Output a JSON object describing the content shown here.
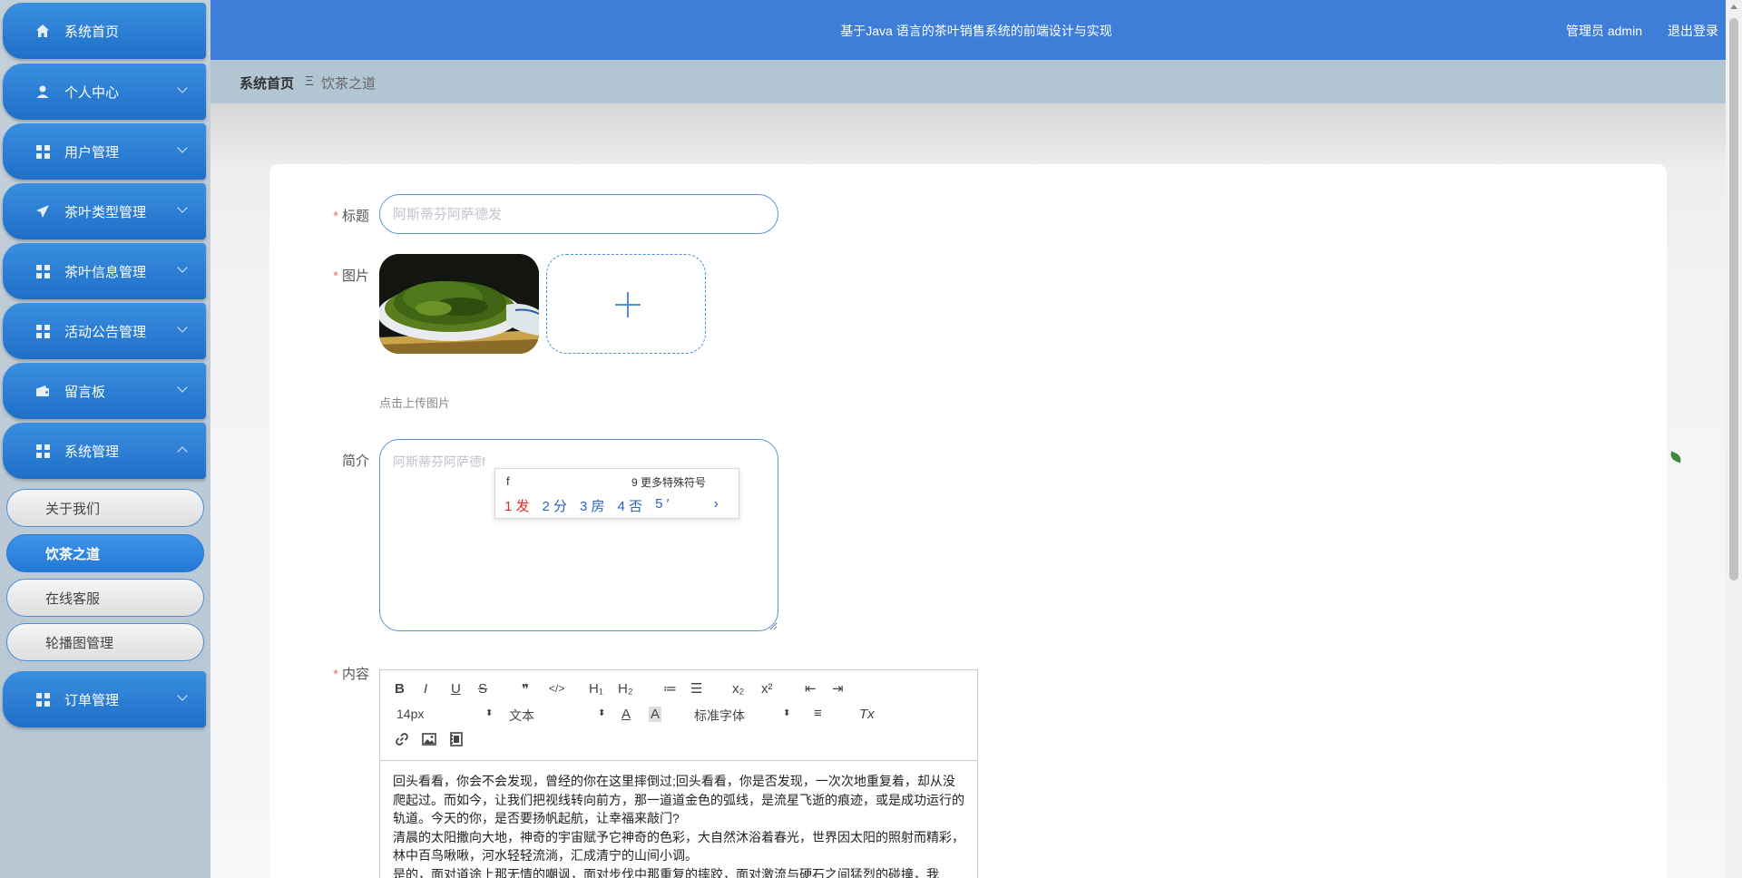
{
  "header": {
    "title": "基于Java 语言的茶叶销售系统的前端设计与实现",
    "user": "管理员 admin",
    "logout": "退出登录"
  },
  "sidebar": {
    "items": [
      {
        "label": "系统首页",
        "icon": "home-icon"
      },
      {
        "label": "个人中心",
        "icon": "user-icon"
      },
      {
        "label": "用户管理",
        "icon": "grid-icon"
      },
      {
        "label": "茶叶类型管理",
        "icon": "paper-plane-icon"
      },
      {
        "label": "茶叶信息管理",
        "icon": "grid-icon"
      },
      {
        "label": "活动公告管理",
        "icon": "grid-icon"
      },
      {
        "label": "留言板",
        "icon": "wallet-icon"
      },
      {
        "label": "系统管理",
        "icon": "grid-icon"
      },
      {
        "label": "订单管理",
        "icon": "grid-icon"
      }
    ],
    "sub_items": [
      {
        "label": "关于我们"
      },
      {
        "label": "饮茶之道"
      },
      {
        "label": "在线客服"
      },
      {
        "label": "轮播图管理"
      }
    ]
  },
  "breadcrumb": {
    "home": "系统首页",
    "separator": "Ξ",
    "current": "饮茶之道"
  },
  "form": {
    "title_label": "标题",
    "title_placeholder": "阿斯蒂芬阿萨德发",
    "image_label": "图片",
    "upload_hint": "点击上传图片",
    "intro_label": "简介",
    "intro_value": "阿斯蒂芬阿萨德f",
    "content_label": "内容",
    "required_mark": "*"
  },
  "ime": {
    "input": "f",
    "more": "9 更多特殊符号",
    "candidates": [
      "1 发",
      "2 分",
      "3 房",
      "4 否",
      "5 ′"
    ],
    "next": "›"
  },
  "editor": {
    "toolbar": {
      "bold": "B",
      "italic": "I",
      "underline": "U",
      "strike": "S",
      "quote": "❞",
      "code": "</>",
      "h1": "H₁",
      "h2": "H₂",
      "ordered_list": "≔",
      "bullet_list": "☰",
      "subscript": "x₂",
      "superscript": "x²",
      "outdent": "⇤",
      "indent": "⇥",
      "font_size": "14px",
      "block": "文本",
      "font_family": "标准字体",
      "color": "A",
      "bg_color": "A",
      "align": "≡",
      "clear": "Tx"
    },
    "paragraphs": [
      "回头看看，你会不会发现，曾经的你在这里摔倒过;回头看看，你是否发现，一次次地重复着，却从没爬起过。而如今，让我们把视线转向前方，那一道道金色的弧线，是流星飞逝的痕迹，或是成功运行的轨道。今天的你，是否要扬帆起航，让幸福来敲门?",
      "清晨的太阳撒向大地，神奇的宇宙赋予它神奇的色彩，大自然沐浴着春光，世界因太阳的照射而精彩，林中百鸟啾啾，河水轻轻流淌，汇成清宁的山间小调。",
      "是的，面对道途上那无情的嘲讽，面对步伐中那重复的摔跤，面对激流与硬石之间猛烈的碰撞，我"
    ]
  },
  "colors": {
    "header_bg": "#3e7ed8",
    "menu_blue": "#2a7bd4",
    "required": "#f56c6c"
  }
}
